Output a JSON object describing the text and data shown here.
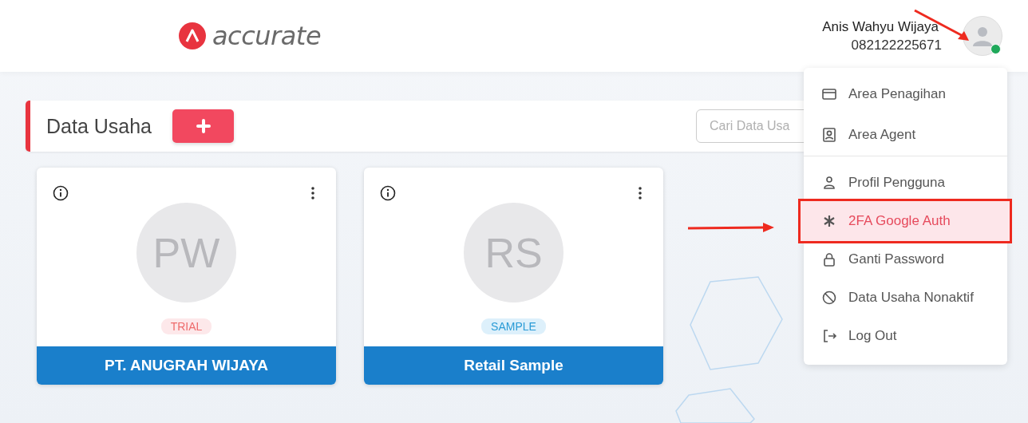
{
  "header": {
    "logo_text": "accurate",
    "user": {
      "name": "Anis Wahyu Wijaya",
      "phone": "082122225671",
      "online": true,
      "annotated": true
    }
  },
  "toolbar": {
    "title": "Data Usaha",
    "search": {
      "placeholder": "Cari Data Usa"
    }
  },
  "cards": [
    {
      "initials": "PW",
      "badge": {
        "kind": "trial",
        "label": "TRIAL"
      },
      "name": "PT. ANUGRAH WIJAYA"
    },
    {
      "initials": "RS",
      "badge": {
        "kind": "sample",
        "label": "SAMPLE"
      },
      "name": "Retail Sample"
    }
  ],
  "user_menu": {
    "items": [
      {
        "kind": "card",
        "label": "Area Penagihan",
        "selected": false,
        "annotated": false,
        "divider_after": false
      },
      {
        "kind": "agent",
        "label": "Area Agent",
        "selected": false,
        "annotated": false,
        "divider_after": true
      },
      {
        "kind": "user",
        "label": "Profil Pengguna",
        "selected": false,
        "annotated": false,
        "divider_after": false
      },
      {
        "kind": "asterisk",
        "label": "2FA Google Auth",
        "selected": true,
        "annotated": true,
        "divider_after": false
      },
      {
        "kind": "lock",
        "label": "Ganti Password",
        "selected": false,
        "annotated": false,
        "divider_after": false
      },
      {
        "kind": "ban",
        "label": "Data Usaha Nonaktif",
        "selected": false,
        "annotated": false,
        "divider_after": false
      },
      {
        "kind": "logout",
        "label": "Log Out",
        "selected": false,
        "annotated": false,
        "divider_after": false
      }
    ]
  }
}
